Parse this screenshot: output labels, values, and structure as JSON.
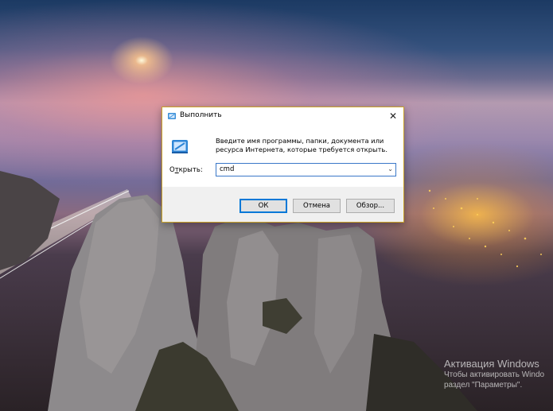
{
  "dialog": {
    "title": "Выполнить",
    "description": "Введите имя программы, папки, документа или ресурса Интернета, которые требуется открыть.",
    "open_label_prefix": "О",
    "open_label_underlined": "т",
    "open_label_suffix": "крыть:",
    "open_value": "cmd",
    "ok_label": "ОК",
    "cancel_label": "Отмена",
    "browse_label": "Обзор...",
    "close_glyph": "✕",
    "dropdown_glyph": "⌄"
  },
  "watermark": {
    "title": "Активация Windows",
    "line1": "Чтобы активировать Windo",
    "line2": "раздел \"Параметры\"."
  },
  "icons": {
    "run": "run-icon",
    "close": "close-icon",
    "dropdown": "chevron-down-icon"
  },
  "colors": {
    "accent": "#0078d7",
    "dialog_border": "#c9a227",
    "footer_bg": "#f0f0f0"
  }
}
